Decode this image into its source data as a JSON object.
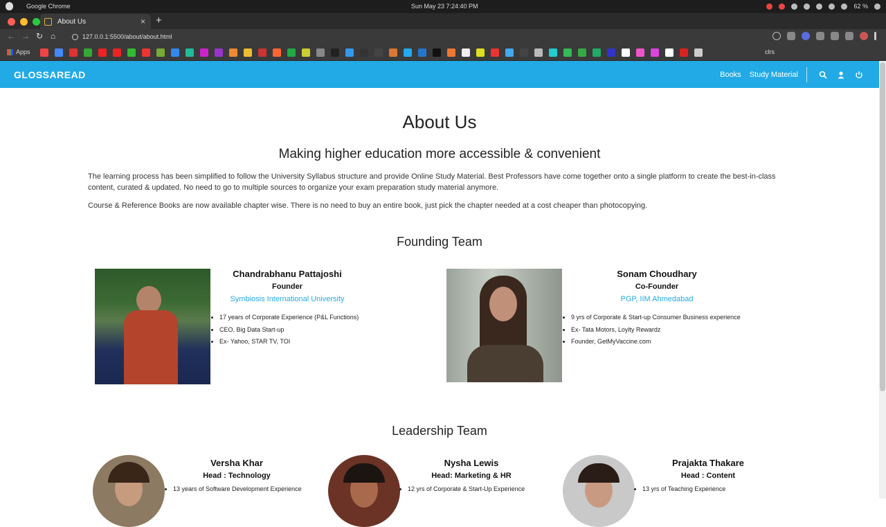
{
  "os": {
    "app_name": "Google Chrome",
    "clock": "Sun May 23   7:24:40 PM",
    "battery": "62 %"
  },
  "browser": {
    "tab_title": "About Us",
    "url": "127.0.0.1:5500/about/about.html",
    "bookmarks": {
      "apps_label": "Apps",
      "clrs_label": "clrs"
    }
  },
  "site": {
    "logo": "GLOSSAREAD",
    "nav": {
      "books": "Books",
      "study_material": "Study Material"
    }
  },
  "page": {
    "title": "About Us",
    "subtitle": "Making higher education more accessible & convenient",
    "paragraph1": "The learning process has been simplified to follow the University Syllabus structure and provide Online Study Material. Best Professors have come together onto a single platform to create the best-in-class content, curated & updated. No need to go to multiple sources to organize your exam preparation study material anymore.",
    "paragraph2": "Course & Reference Books are now available chapter wise. There is no need to buy an entire book, just pick the chapter needed at a cost cheaper than photocopying.",
    "founding_title": "Founding Team",
    "leadership_title": "Leadership Team"
  },
  "founders": [
    {
      "name": "Chandrabhanu Pattajoshi",
      "role": "Founder",
      "edu": "Symbiosis International University",
      "points": [
        "17 years of Corporate Experience (P&L Functions)",
        "CEO, Big Data Start-up",
        "Ex- Yahoo, STAR TV, TOI"
      ]
    },
    {
      "name": "Sonam Choudhary",
      "role": "Co-Founder",
      "edu": "PGP, IIM Ahmedabad",
      "points": [
        "9 yrs of Corporate & Start-up Consumer Business experience",
        "Ex- Tata Motors, Loylty Rewardz",
        "Founder, GetMyVaccine.com"
      ]
    }
  ],
  "leaders": [
    {
      "name": "Versha Khar",
      "role": "Head : Technology",
      "point": "13 years of Software Development Experience"
    },
    {
      "name": "Nysha Lewis",
      "role": "Head: Marketing & HR",
      "point": "12 yrs of Corporate & Start-Up Experience"
    },
    {
      "name": "Prajakta Thakare",
      "role": "Head : Content",
      "point": "13 yrs of Teaching Experience"
    }
  ],
  "colors": {
    "brand": "#22aae6"
  }
}
